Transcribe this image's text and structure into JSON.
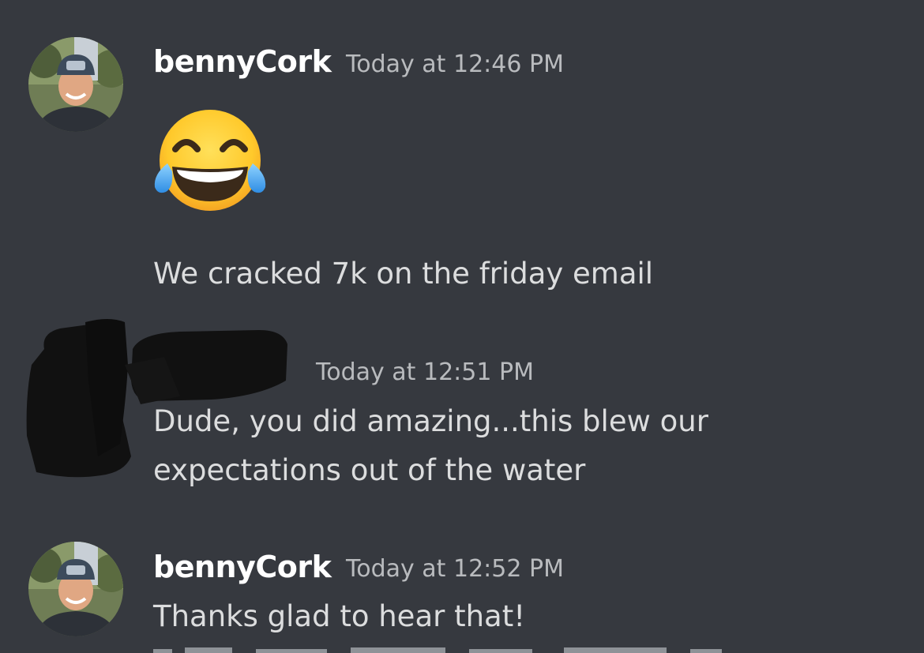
{
  "messages": [
    {
      "username": "bennyCork",
      "timestamp": "Today at 12:46 PM",
      "emoji": "face-with-tears-of-joy-icon",
      "text": "We cracked 7k on the friday email"
    },
    {
      "username": "",
      "timestamp": "Today at 12:51 PM",
      "text_line1": "Dude, you did amazing...this blew our",
      "text_line2": "expectations out of the water"
    },
    {
      "username": "bennyCork",
      "timestamp": "Today at 12:52 PM",
      "text": "Thanks glad to hear that!"
    }
  ],
  "colors": {
    "background": "#36393f",
    "username": "#ffffff",
    "timestamp": "#b9bbbe",
    "text": "#dcddde"
  }
}
